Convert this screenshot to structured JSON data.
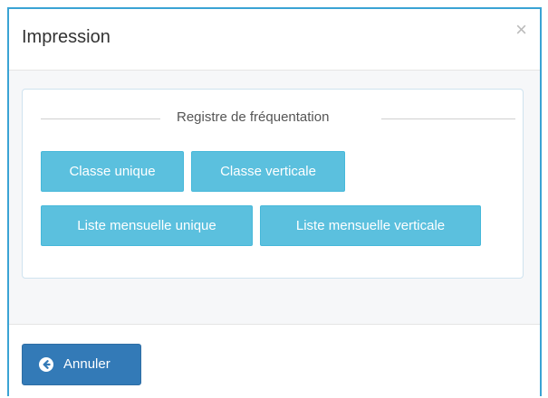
{
  "modal": {
    "title": "Impression",
    "close_label": "×"
  },
  "panel": {
    "legend": "Registre de fréquentation",
    "buttons": [
      {
        "label": "Classe unique"
      },
      {
        "label": "Classe verticale"
      },
      {
        "label": "Liste mensuelle unique"
      },
      {
        "label": "Liste mensuelle verticale"
      }
    ]
  },
  "footer": {
    "cancel_label": "Annuler",
    "cancel_icon": "circle-arrow-left-icon"
  },
  "colors": {
    "info_button": "#5bc0de",
    "primary_button": "#337ab7",
    "modal_border": "#3aa3d4"
  }
}
